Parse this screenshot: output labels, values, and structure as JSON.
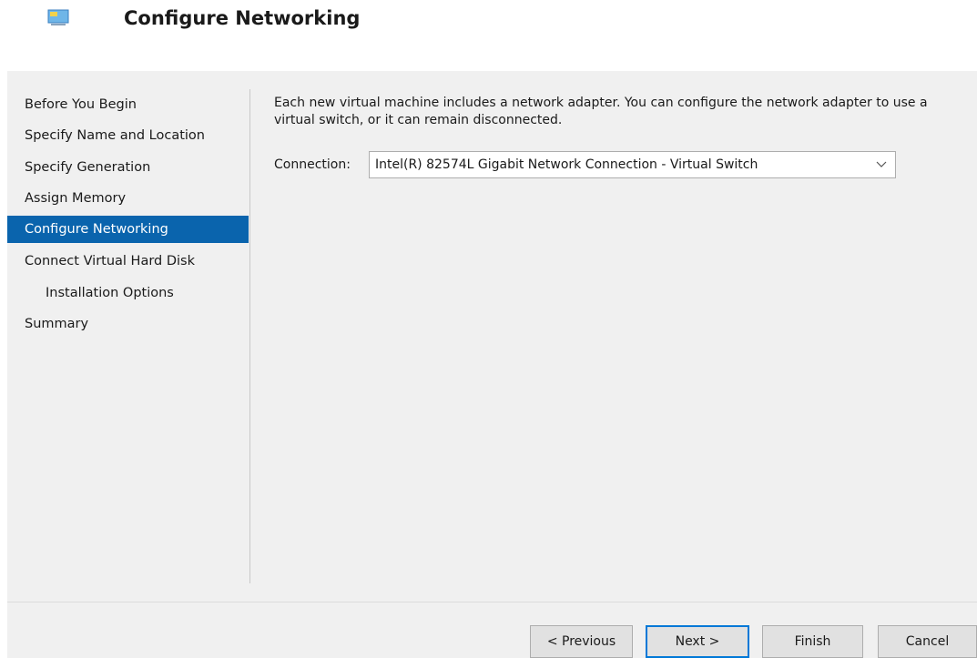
{
  "header": {
    "title": "Configure Networking",
    "icon": "monitor-icon"
  },
  "nav": {
    "items": [
      {
        "label": "Before You Begin",
        "active": false,
        "sub": false
      },
      {
        "label": "Specify Name and Location",
        "active": false,
        "sub": false
      },
      {
        "label": "Specify Generation",
        "active": false,
        "sub": false
      },
      {
        "label": "Assign Memory",
        "active": false,
        "sub": false
      },
      {
        "label": "Configure Networking",
        "active": true,
        "sub": false
      },
      {
        "label": "Connect Virtual Hard Disk",
        "active": false,
        "sub": false
      },
      {
        "label": "Installation Options",
        "active": false,
        "sub": true
      },
      {
        "label": "Summary",
        "active": false,
        "sub": false
      }
    ]
  },
  "main": {
    "description_line1": "Each new virtual machine includes a network adapter. You can configure the network adapter to use a",
    "description_line2": "virtual switch, or it can remain disconnected.",
    "connection_label": "Connection:",
    "connection_value": "Intel(R) 82574L Gigabit Network Connection - Virtual Switch",
    "dropdown_icon": "chevron-down-icon"
  },
  "footer": {
    "previous_label": "< Previous",
    "next_label": "Next >",
    "finish_label": "Finish",
    "cancel_label": "Cancel"
  },
  "colors": {
    "selection": "#0a64ad",
    "panel": "#f0f0f0",
    "focus_border": "#0078d7"
  }
}
